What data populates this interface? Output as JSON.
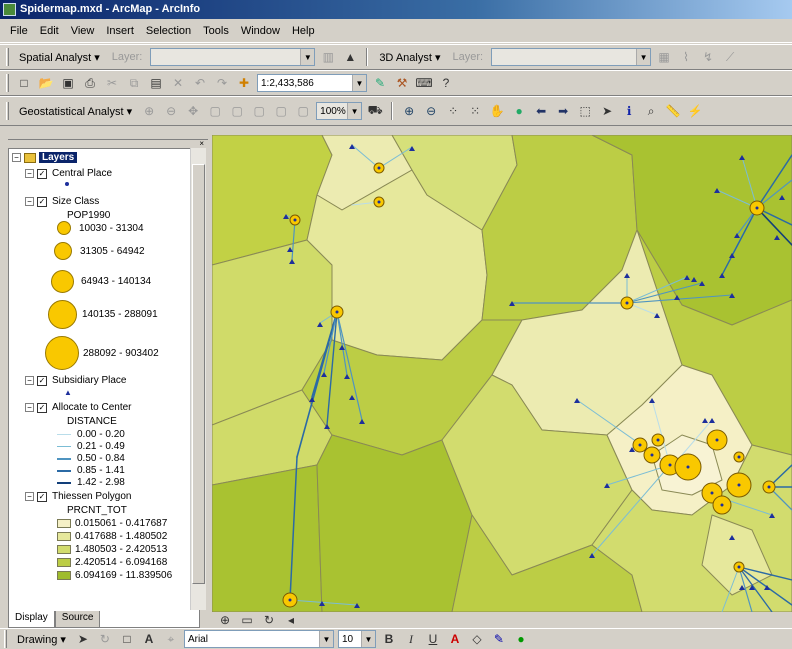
{
  "window": {
    "title": "Spidermap.mxd - ArcMap - ArcInfo"
  },
  "menu": [
    "File",
    "Edit",
    "View",
    "Insert",
    "Selection",
    "Tools",
    "Window",
    "Help"
  ],
  "toolbar1": {
    "spatial_analyst": "Spatial Analyst ▾",
    "layer_label": "Layer:",
    "analyst3d": "3D Analyst ▾",
    "layer_label2": "Layer:"
  },
  "toolbar2": {
    "scale": "1:2,433,586"
  },
  "toolbar3": {
    "geostat": "Geostatistical Analyst ▾",
    "zoom_pct": "100%"
  },
  "toc": {
    "root": "Layers",
    "central_place": "Central Place",
    "size_class": "Size Class",
    "pop_field": "POP1990",
    "size_classes": [
      "10030 - 31304",
      "31305 - 64942",
      "64943 - 140134",
      "140135 - 288091",
      "288092 - 903402"
    ],
    "subsidiary": "Subsidiary Place",
    "allocate": "Allocate to Center",
    "distance_field": "DISTANCE",
    "distance_classes": [
      "0.00 - 0.20",
      "0.21 - 0.49",
      "0.50 - 0.84",
      "0.85 - 1.41",
      "1.42 - 2.98"
    ],
    "thiessen": "Thiessen Polygon",
    "prcnt_field": "PRCNT_TOT",
    "prcnt_classes": [
      "0.015061 - 0.417687",
      "0.417688 - 1.480502",
      "1.480503 - 2.420513",
      "2.420514 - 6.094168",
      "6.094169 - 11.839506"
    ],
    "prcnt_colors": [
      "#f5f0c6",
      "#e6e89c",
      "#d2dc6e",
      "#bccd45",
      "#9fbc2c"
    ],
    "tabs": {
      "display": "Display",
      "source": "Source"
    }
  },
  "drawbar": {
    "drawing": "Drawing ▾",
    "font": "Arial",
    "size": "10",
    "bold": "B",
    "italic": "I",
    "underline": "U"
  }
}
